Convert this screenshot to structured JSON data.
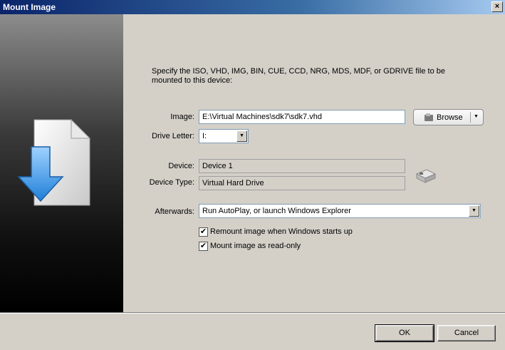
{
  "window": {
    "title": "Mount Image",
    "close_glyph": "×"
  },
  "description": "Specify the ISO, VHD, IMG, BIN, CUE, CCD, NRG, MDS, MDF, or GDRIVE file to be mounted to this device:",
  "image": {
    "label": "Image:",
    "value": "E:\\Virtual Machines\\sdk7\\sdk7.vhd"
  },
  "browse": {
    "label": "Browse"
  },
  "drive_letter": {
    "label": "Drive Letter:",
    "value": "I:"
  },
  "device": {
    "label": "Device:",
    "value": "Device 1"
  },
  "device_type": {
    "label": "Device Type:",
    "value": "Virtual Hard Drive"
  },
  "afterwards": {
    "label": "Afterwards:",
    "value": "Run AutoPlay, or launch Windows Explorer"
  },
  "options": [
    {
      "label": "Remount image when Windows starts up",
      "checked": true
    },
    {
      "label": "Mount image as read-only",
      "checked": true
    }
  ],
  "buttons": {
    "ok": "OK",
    "cancel": "Cancel"
  },
  "icons": {
    "close": "close-icon",
    "document_download": "document-download-icon",
    "browse": "folder-icon",
    "drive": "hard-drive-icon",
    "dropdown": "chevron-down-icon",
    "check": "checkmark-icon"
  },
  "colors": {
    "title_bar": "#0a246a",
    "dialog_bg": "#d4d0c8",
    "arrow_blue": "#3a9be8"
  }
}
